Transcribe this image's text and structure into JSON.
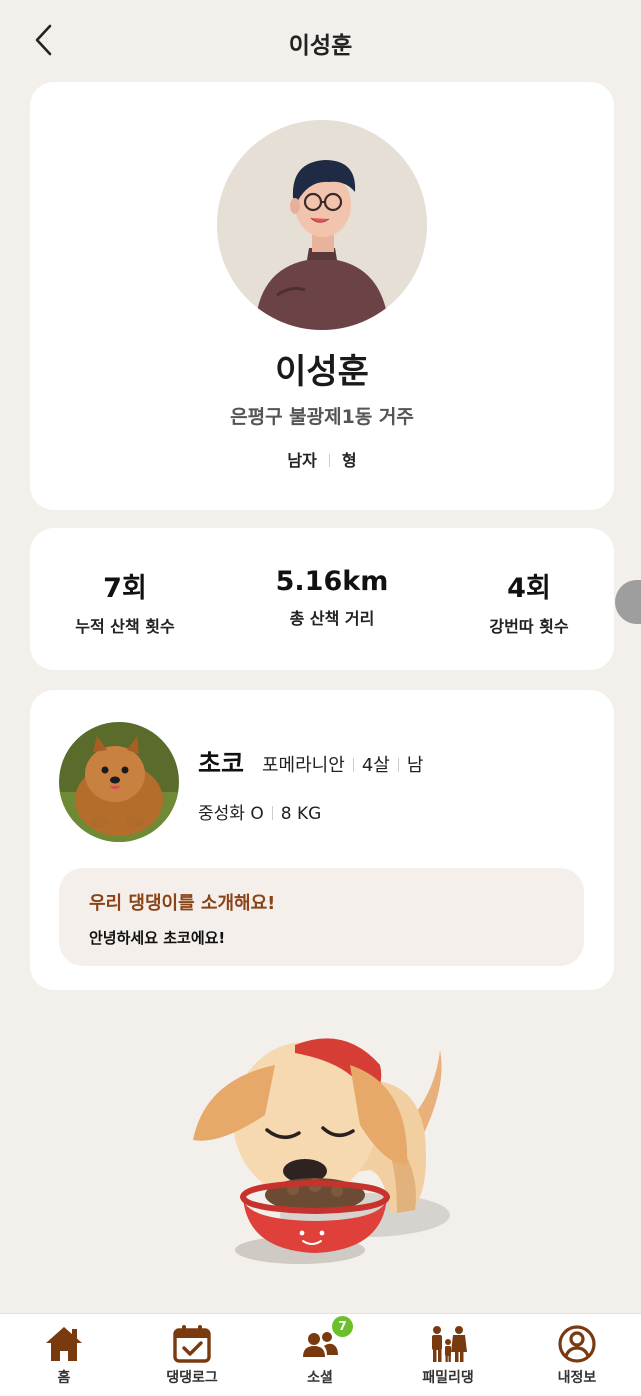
{
  "header": {
    "title": "이성훈"
  },
  "profile": {
    "name": "이성훈",
    "location": "은평구 불광제1동 거주",
    "gender": "남자",
    "role": "형"
  },
  "stats": [
    {
      "value": "7회",
      "label": "누적 산책 횟수"
    },
    {
      "value": "5.16km",
      "label": "총 산책 거리"
    },
    {
      "value": "4회",
      "label": "강번따 횟수"
    }
  ],
  "dog": {
    "name": "초코",
    "breed": "포메라니안",
    "age": "4살",
    "sex": "남",
    "neutered": "중성화 O",
    "weight": "8 KG",
    "intro_title": "우리 댕댕이를 소개해요!",
    "intro_text": "안녕하세요 초코에요!"
  },
  "nav": {
    "items": [
      {
        "label": "홈",
        "icon": "home-icon"
      },
      {
        "label": "댕댕로그",
        "icon": "calendar-check-icon"
      },
      {
        "label": "소셜",
        "icon": "people-icon",
        "badge": "7"
      },
      {
        "label": "패밀리댕",
        "icon": "family-icon"
      },
      {
        "label": "내정보",
        "icon": "user-circle-icon"
      }
    ]
  },
  "colors": {
    "background": "#f3f0ec",
    "accent_brown": "#8a4418",
    "nav_icon": "#7a3a10",
    "badge_green": "#6bbf2c"
  }
}
